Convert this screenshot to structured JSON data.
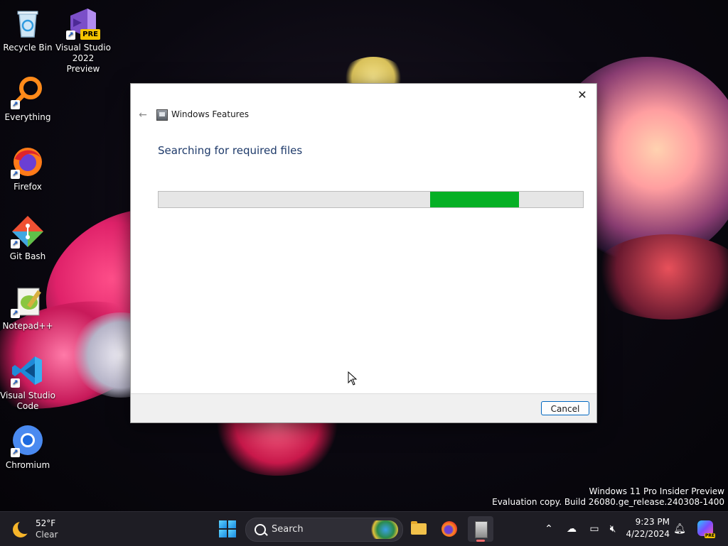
{
  "desktop": {
    "icons": [
      {
        "label": "Recycle Bin"
      },
      {
        "label": "Visual Studio 2022 Preview",
        "badge": "PRE"
      },
      {
        "label": "Everything"
      },
      {
        "label": "Firefox"
      },
      {
        "label": "Git Bash"
      },
      {
        "label": "Notepad++"
      },
      {
        "label": "Visual Studio Code"
      },
      {
        "label": "Chromium"
      }
    ],
    "watermark": {
      "line1": "Windows 11 Pro Insider Preview",
      "line2": "Evaluation copy. Build 26080.ge_release.240308-1400"
    }
  },
  "dialog": {
    "title": "Windows Features",
    "heading": "Searching for required files",
    "progress": {
      "segment_start": 0.64,
      "segment_end": 0.85,
      "color": "#06b025"
    },
    "cancel_label": "Cancel",
    "close_glyph": "✕",
    "back_glyph": "←"
  },
  "taskbar": {
    "weather": {
      "temp": "52°F",
      "condition": "Clear"
    },
    "search_placeholder": "Search",
    "clock": {
      "time": "9:23 PM",
      "date": "4/22/2024"
    },
    "copilot_badge": "PRE",
    "accent": "#1e1d24"
  }
}
